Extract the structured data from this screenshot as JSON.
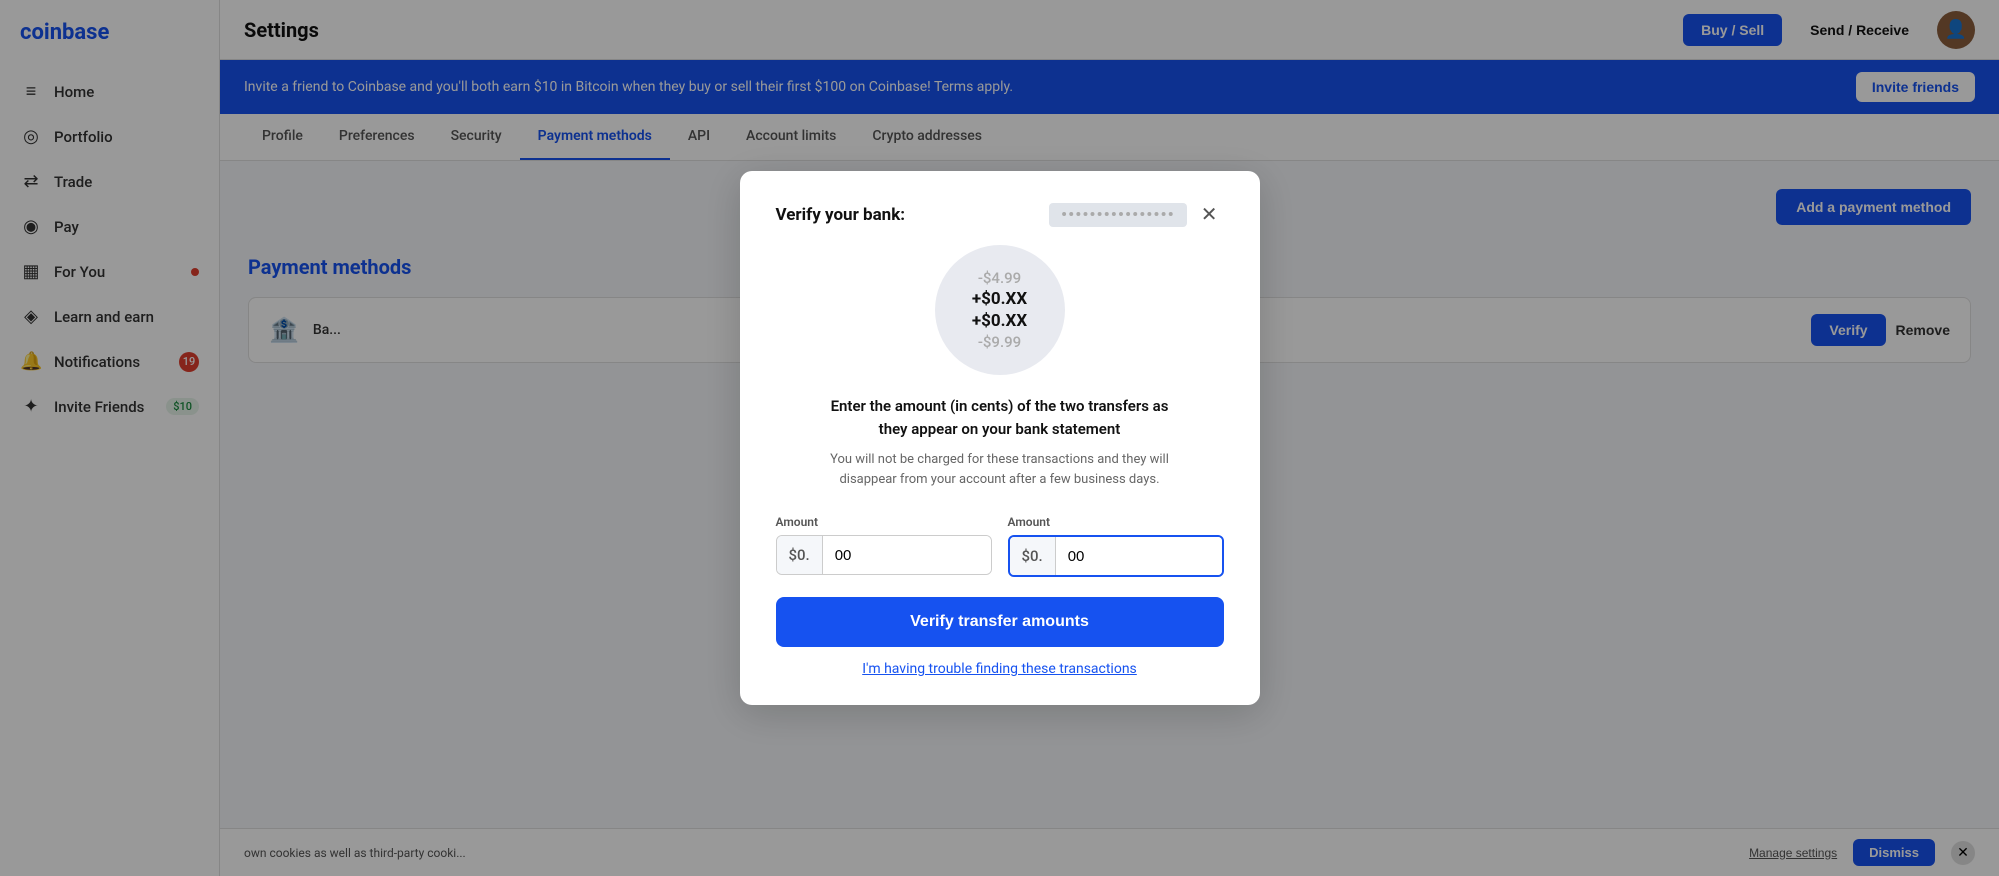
{
  "sidebar": {
    "logo": "coinbase",
    "items": [
      {
        "id": "home",
        "label": "Home",
        "icon": "≡",
        "badge": null
      },
      {
        "id": "portfolio",
        "label": "Portfolio",
        "icon": "◎",
        "badge": null
      },
      {
        "id": "trade",
        "label": "Trade",
        "icon": "↔",
        "badge": null
      },
      {
        "id": "pay",
        "label": "Pay",
        "icon": "◉",
        "badge": null
      },
      {
        "id": "for-you",
        "label": "For You",
        "icon": "▦",
        "badge": "dot"
      },
      {
        "id": "learn-and-earn",
        "label": "Learn and earn",
        "icon": "◈",
        "badge": null
      },
      {
        "id": "notifications",
        "label": "Notifications",
        "icon": "◎",
        "badge": "19"
      },
      {
        "id": "invite-friends",
        "label": "Invite Friends",
        "icon": "✦",
        "badge": "$10"
      }
    ]
  },
  "topnav": {
    "title": "Settings",
    "buy_sell_label": "Buy / Sell",
    "send_receive_label": "Send / Receive"
  },
  "banner": {
    "text": "Invite a friend to Coinbase and you'll both earn $10 in Bitcoin when they buy or sell their first $100 on Coinbase! Terms apply.",
    "invite_label": "Invite friends"
  },
  "tabs": [
    {
      "id": "profile",
      "label": "Profile",
      "active": false
    },
    {
      "id": "preferences",
      "label": "Preferences",
      "active": false
    },
    {
      "id": "security",
      "label": "Security",
      "active": false
    },
    {
      "id": "payment-methods",
      "label": "Payment methods",
      "active": true
    },
    {
      "id": "api",
      "label": "API",
      "active": false
    },
    {
      "id": "account-limits",
      "label": "Account limits",
      "active": false
    },
    {
      "id": "crypto-addresses",
      "label": "Crypto addresses",
      "active": false
    }
  ],
  "content": {
    "payment_methods_title": "Payment methods",
    "add_payment_label": "Add a payment method",
    "bank_name_masked": "Bank",
    "bank_label": "Ba...",
    "verify_label": "Verify",
    "remove_label": "Remove"
  },
  "cookie_bar": {
    "text": "own cookies as well as third-party cooki...",
    "manage_label": "Manage settings",
    "dismiss_label": "Dismiss"
  },
  "modal": {
    "title": "Verify your bank:",
    "bank_name_masked": "••••••••••••••••••••",
    "coin_values": [
      {
        "text": "-$4.99",
        "style": "muted"
      },
      {
        "text": "+$0.XX",
        "style": "primary"
      },
      {
        "text": "+$0.XX",
        "style": "primary"
      },
      {
        "text": "-$9.99",
        "style": "muted"
      }
    ],
    "instruction": "Enter the amount (in cents) of the two transfers as\nthey appear on your bank statement",
    "note": "You will not be charged for these transactions and they will\ndisappear from your account after a few business days.",
    "amount1": {
      "label": "Amount",
      "prefix": "$0.",
      "value": "00",
      "placeholder": "00"
    },
    "amount2": {
      "label": "Amount",
      "prefix": "$0.",
      "value": "00",
      "placeholder": "00"
    },
    "verify_button": "Verify transfer amounts",
    "trouble_link": "I'm having trouble finding these transactions"
  },
  "colors": {
    "primary": "#1652f0",
    "danger": "#e03e2d",
    "muted": "#aaa"
  }
}
